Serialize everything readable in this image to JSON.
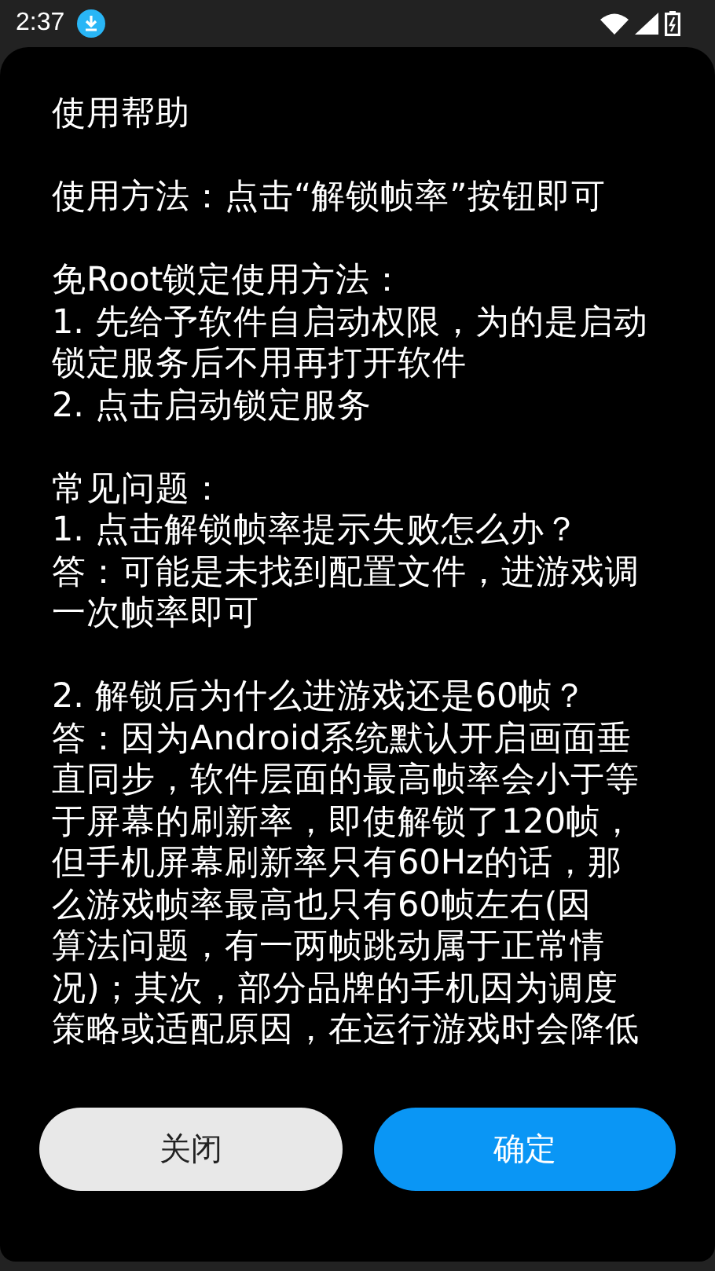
{
  "status_bar": {
    "time": "2:37"
  },
  "dialog": {
    "title": "使用帮助",
    "paragraphs": [
      {
        "lines": [
          "使用方法：点击“解锁帧率”按钮即可"
        ]
      },
      {
        "lines": [
          "免Root锁定使用方法：",
          "1. 先给予软件自启动权限，为的是启动",
          "锁定服务后不用再打开软件",
          "2. 点击启动锁定服务"
        ]
      },
      {
        "lines": [
          "常见问题：",
          "1. 点击解锁帧率提示失败怎么办？",
          "答：可能是未找到配置文件，进游戏调",
          "一次帧率即可"
        ]
      },
      {
        "lines": [
          "2. 解锁后为什么进游戏还是60帧？",
          "答：因为Android系统默认开启画面垂",
          "直同步，软件层面的最高帧率会小于等",
          "于屏幕的刷新率，即使解锁了120帧，",
          "但手机屏幕刷新率只有60Hz的话，那",
          "么游戏帧率最高也只有60帧左右(因",
          "算法问题，有一两帧跳动属于正常情",
          "况)；其次，部分品牌的手机因为调度",
          "策略或适配原因，在运行游戏时会降低"
        ]
      }
    ],
    "buttons": [
      {
        "kind": "secondary",
        "label": "关闭"
      },
      {
        "kind": "primary",
        "label": "确定"
      }
    ]
  }
}
